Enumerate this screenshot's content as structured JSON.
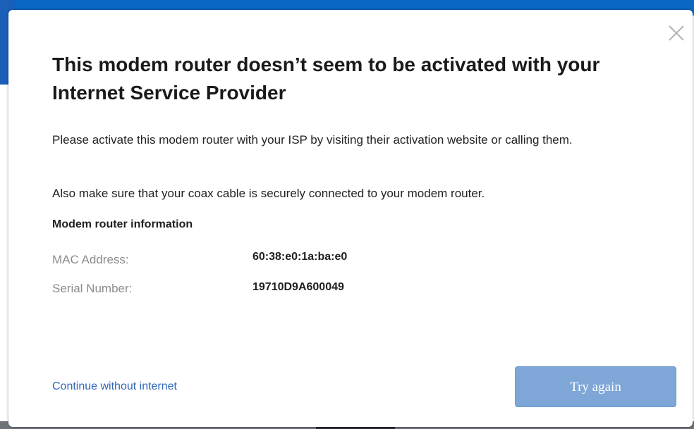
{
  "dialog": {
    "title": "This modem router doesn’t seem to be activated with your Internet Service Provider",
    "message_activate": "Please activate this modem router with your ISP by visiting their activation website or calling them.",
    "message_coax": "Also make sure that your coax cable is securely connected to your modem router.",
    "info_section_title": "Modem router information",
    "mac_label": "MAC Address:",
    "mac_value": "60:38:e0:1a:ba:e0",
    "serial_label": "Serial Number:",
    "serial_value": "19710D9A600049",
    "continue_label": "Continue without internet",
    "try_again_label": "Try again",
    "close_icon": "close-icon"
  },
  "colors": {
    "background_bar": "#0a66c2",
    "link": "#2f67b8",
    "button": "#7ea6d7"
  }
}
